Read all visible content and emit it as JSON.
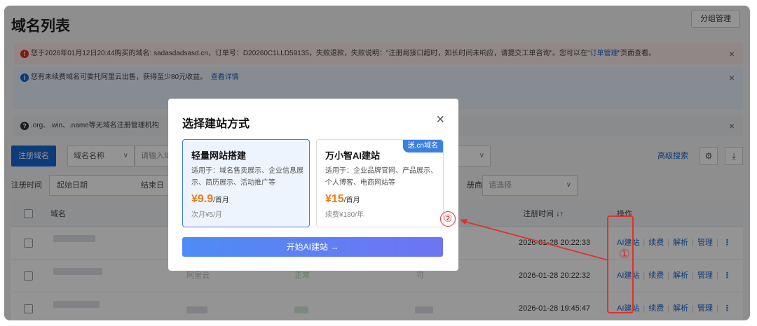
{
  "header": {
    "title": "域名列表",
    "group_manage": "分组管理"
  },
  "alerts": {
    "error": {
      "icon": "error-icon",
      "text_before": "您于2026年01月12日20:44购买的域名: sadasdadsasd.cn，订单号：D20260C1LLD59135，失败退款，失败说明：\"注册局接口超时，如长时间未响应，请提交工单咨询\"。您可以在\"",
      "link": "订单管理",
      "text_after": "\"页面查看。"
    },
    "info": {
      "icon": "info-icon",
      "text": "您有未续费域名可委托阿里云出售，获得至少80元收益。",
      "link": "查看详情"
    },
    "help": {
      "icon": "help-icon",
      "text": ".org、.win、.name等无域名注册管理机构"
    },
    "close": "×"
  },
  "toolbar": {
    "register_btn": "注册域名",
    "field_select": "域名名称",
    "search_placeholder": "请输入域",
    "second_select_arrow": "∨",
    "adv_search": "高级搜索"
  },
  "filter": {
    "reg_time_label": "注册时间",
    "start_date": "起始日期",
    "end_date": "结束日",
    "suffix": "册商",
    "select_placeholder": "请选择"
  },
  "table": {
    "columns": {
      "domain": "域名",
      "reg_time": "注册时间",
      "ops": "操作"
    },
    "rows": [
      {
        "reg_time": "2026-01-28 20:22:33",
        "col_a": "",
        "col_b": "",
        "col_c": ""
      },
      {
        "reg_time": "2026-01-28 20:22:32",
        "col_a": "阿里云",
        "col_b": "正常",
        "col_c": "可"
      },
      {
        "reg_time": "2026-01-28 19:45:47",
        "col_a": "",
        "col_b": "",
        "col_c": ""
      }
    ],
    "ops": {
      "ai": "AI建站",
      "renew": "续费",
      "dns": "解析",
      "manage": "管理",
      "more": "⋮"
    }
  },
  "modal": {
    "title": "选择建站方式",
    "close": "×",
    "card1": {
      "title": "轻量网站搭建",
      "desc": "适用于：域名售卖展示、企业信息展示、简历展示、活动推广等",
      "price": "¥9.9",
      "unit": "/首月",
      "renew": "次月¥5/月"
    },
    "card2": {
      "badge": "送.cn域名",
      "title": "万小智AI建站",
      "desc": "适用于：企业品牌官网、产品展示、个人博客、电商网站等",
      "price": "¥15",
      "unit": "/首月",
      "renew": "续费¥180/年"
    },
    "start_btn": "开始AI建站 →"
  },
  "annotations": {
    "step1": "①",
    "step2": "②"
  },
  "colors": {
    "primary": "#1967d2",
    "price": "#f07a13",
    "annotation": "#e0322b"
  }
}
